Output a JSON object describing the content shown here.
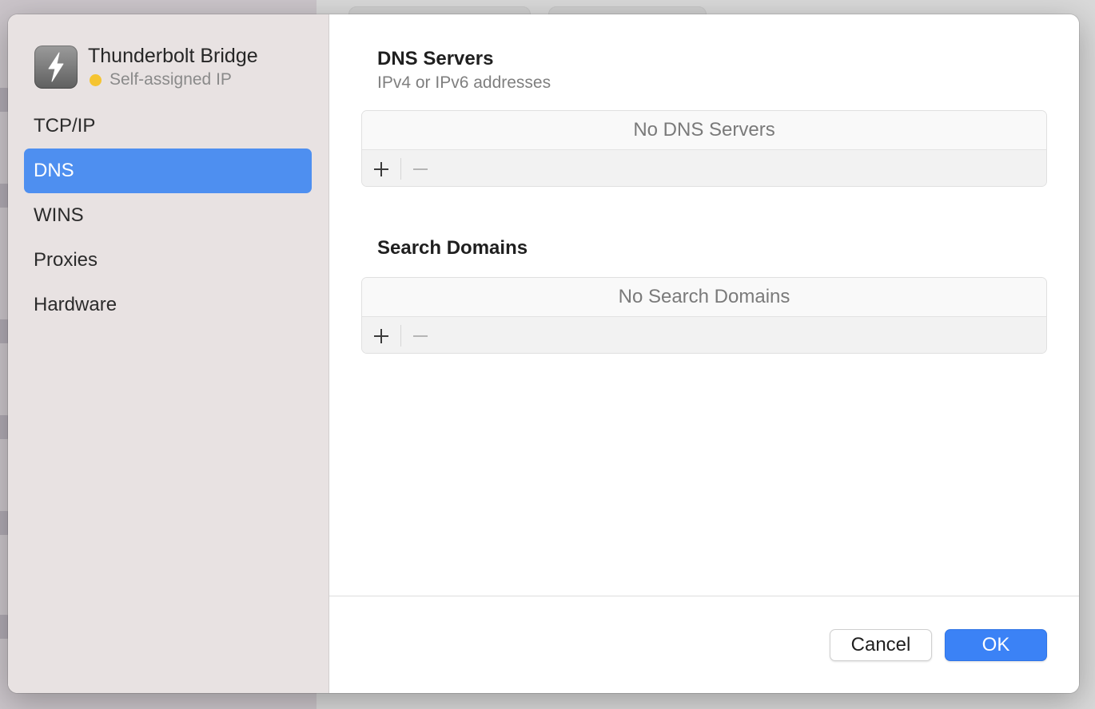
{
  "service": {
    "name": "Thunderbolt Bridge",
    "status": "Self-assigned IP",
    "status_color": "#f5c431",
    "icon": "thunderbolt-icon"
  },
  "sidebar": {
    "items": [
      {
        "label": "TCP/IP",
        "selected": false
      },
      {
        "label": "DNS",
        "selected": true
      },
      {
        "label": "WINS",
        "selected": false
      },
      {
        "label": "Proxies",
        "selected": false
      },
      {
        "label": "Hardware",
        "selected": false
      }
    ]
  },
  "dns_servers": {
    "title": "DNS Servers",
    "subtitle": "IPv4 or IPv6 addresses",
    "empty_text": "No DNS Servers"
  },
  "search_domains": {
    "title": "Search Domains",
    "empty_text": "No Search Domains"
  },
  "footer": {
    "cancel_label": "Cancel",
    "ok_label": "OK"
  },
  "colors": {
    "accent": "#3b82f6",
    "selection": "#4e8ff0",
    "sidebar_bg": "#e8e2e2"
  }
}
